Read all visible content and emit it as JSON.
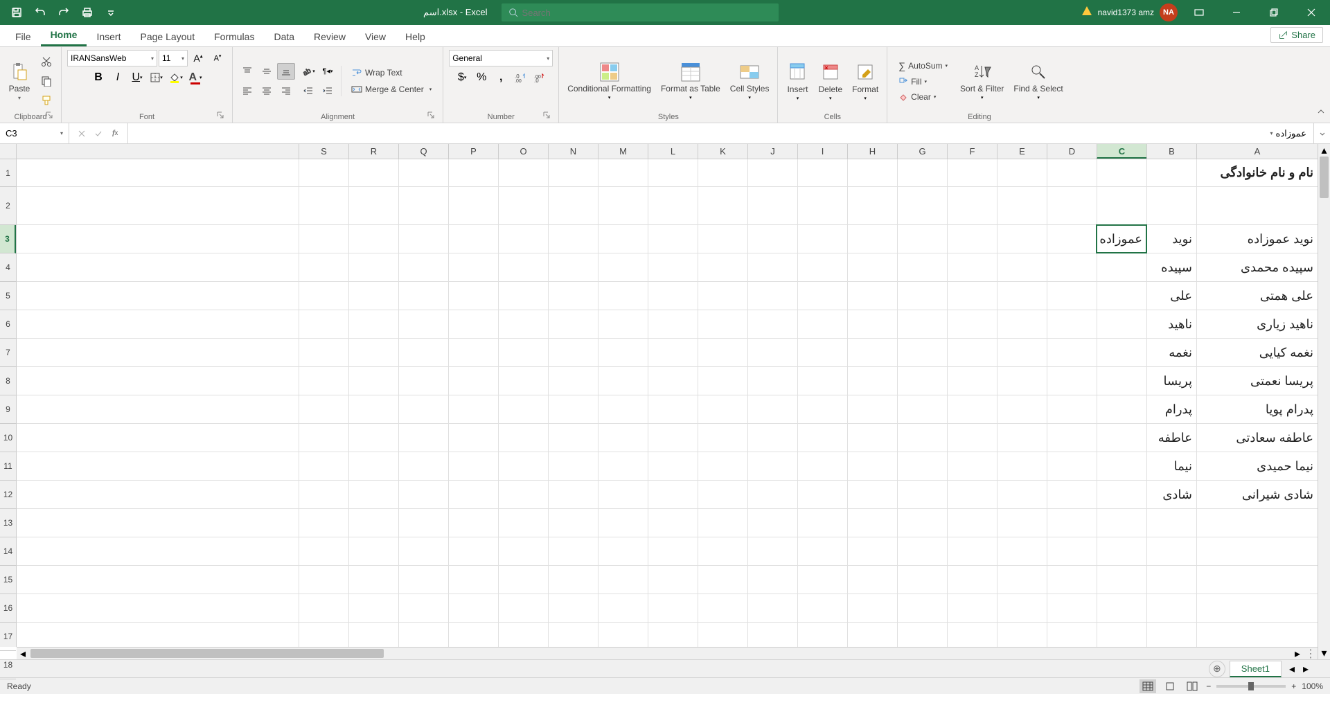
{
  "titlebar": {
    "doc_title": "اسم.xlsx - Excel",
    "search_placeholder": "Search",
    "user_name": "navid1373 amz",
    "user_initials": "NA"
  },
  "tabs": {
    "file": "File",
    "home": "Home",
    "insert": "Insert",
    "page_layout": "Page Layout",
    "formulas": "Formulas",
    "data": "Data",
    "review": "Review",
    "view": "View",
    "help": "Help",
    "share": "Share"
  },
  "ribbon": {
    "clipboard": {
      "label": "Clipboard",
      "paste": "Paste"
    },
    "font": {
      "label": "Font",
      "name": "IRANSansWeb",
      "size": "11"
    },
    "alignment": {
      "label": "Alignment",
      "wrap": "Wrap Text",
      "merge": "Merge & Center"
    },
    "number": {
      "label": "Number",
      "format": "General"
    },
    "styles": {
      "label": "Styles",
      "conditional": "Conditional Formatting",
      "table": "Format as Table",
      "cell": "Cell Styles"
    },
    "cells": {
      "label": "Cells",
      "insert": "Insert",
      "delete": "Delete",
      "format": "Format"
    },
    "editing": {
      "label": "Editing",
      "autosum": "AutoSum",
      "fill": "Fill",
      "clear": "Clear",
      "sort": "Sort & Filter",
      "find": "Find & Select"
    }
  },
  "formula_bar": {
    "name_box": "C3",
    "formula": "عموزاده"
  },
  "grid": {
    "columns": [
      "A",
      "B",
      "C",
      "D",
      "E",
      "F",
      "G",
      "H",
      "I",
      "J",
      "K",
      "L",
      "M",
      "N",
      "O",
      "P",
      "Q",
      "R",
      "S"
    ],
    "col_widths": {
      "A": 175,
      "default": 72
    },
    "row_heights": {
      "1": 40,
      "2": 55,
      "default": 41
    },
    "selected_cell": {
      "row": 3,
      "col": "C"
    },
    "rows": [
      {
        "n": 1,
        "cells": {
          "A": {
            "v": "نام و نام خانوادگی",
            "bold": true
          }
        }
      },
      {
        "n": 2,
        "cells": {}
      },
      {
        "n": 3,
        "cells": {
          "A": {
            "v": "نوید عموزاده"
          },
          "B": {
            "v": "نوید"
          },
          "C": {
            "v": "عموزاده"
          }
        }
      },
      {
        "n": 4,
        "cells": {
          "A": {
            "v": "سپیده محمدی"
          },
          "B": {
            "v": "سپیده"
          }
        }
      },
      {
        "n": 5,
        "cells": {
          "A": {
            "v": "علی همتی"
          },
          "B": {
            "v": "علی"
          }
        }
      },
      {
        "n": 6,
        "cells": {
          "A": {
            "v": "ناهید زیاری"
          },
          "B": {
            "v": "ناهید"
          }
        }
      },
      {
        "n": 7,
        "cells": {
          "A": {
            "v": "نغمه کیایی"
          },
          "B": {
            "v": "نغمه"
          }
        }
      },
      {
        "n": 8,
        "cells": {
          "A": {
            "v": "پریسا نعمتی"
          },
          "B": {
            "v": "پریسا"
          }
        }
      },
      {
        "n": 9,
        "cells": {
          "A": {
            "v": "پدرام پویا"
          },
          "B": {
            "v": "پدرام"
          }
        }
      },
      {
        "n": 10,
        "cells": {
          "A": {
            "v": "عاطفه سعادتی"
          },
          "B": {
            "v": "عاطفه"
          }
        }
      },
      {
        "n": 11,
        "cells": {
          "A": {
            "v": "نیما حمیدی"
          },
          "B": {
            "v": "نیما"
          }
        }
      },
      {
        "n": 12,
        "cells": {
          "A": {
            "v": "شادی شیرانی"
          },
          "B": {
            "v": "شادی"
          }
        }
      }
    ]
  },
  "sheet_bar": {
    "sheets": [
      "Sheet1"
    ]
  },
  "status": {
    "ready": "Ready",
    "zoom": "100%"
  }
}
